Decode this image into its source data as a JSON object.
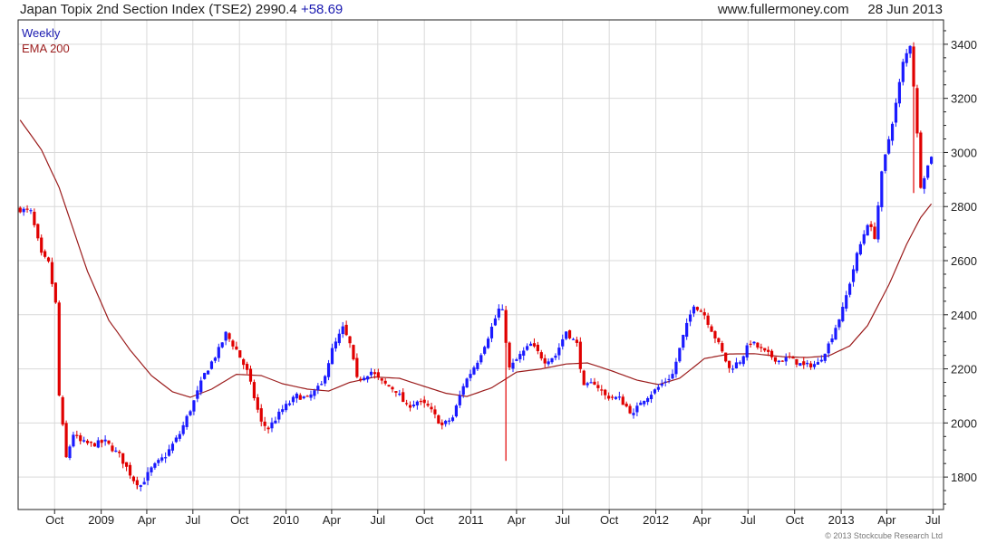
{
  "header": {
    "title": "Japan Topix 2nd Section Index (TSE2)",
    "last_value": "2990.4",
    "change": "+58.69",
    "website": "www.fullermoney.com",
    "date": "28 Jun 2013"
  },
  "copyright": "© 2013 Stockcube Research Ltd",
  "colors": {
    "up": "#1a1aff",
    "down": "#e00000",
    "ema": "#9b1c1c",
    "grid": "#d9d9d9",
    "frame": "#222222",
    "weekly_label": "#1a1ab0"
  },
  "chart_data": {
    "type": "candlestick",
    "frequency_label": "Weekly",
    "ema_label": "EMA 200",
    "x_range": [
      "2008-07-21",
      "2013-07-22"
    ],
    "y_range": [
      1680,
      3490
    ],
    "y_axis_side": "right",
    "grid": true,
    "y_ticks": [
      1800,
      2000,
      2200,
      2400,
      2600,
      2800,
      3000,
      3200,
      3400
    ],
    "x_ticks": [
      {
        "label": "Oct",
        "date": "2008-10-01"
      },
      {
        "label": "2009",
        "date": "2009-01-01"
      },
      {
        "label": "Apr",
        "date": "2009-04-01"
      },
      {
        "label": "Jul",
        "date": "2009-07-01"
      },
      {
        "label": "Oct",
        "date": "2009-10-01"
      },
      {
        "label": "2010",
        "date": "2010-01-01"
      },
      {
        "label": "Apr",
        "date": "2010-04-01"
      },
      {
        "label": "Jul",
        "date": "2010-07-01"
      },
      {
        "label": "Oct",
        "date": "2010-10-01"
      },
      {
        "label": "2011",
        "date": "2011-01-01"
      },
      {
        "label": "Apr",
        "date": "2011-04-01"
      },
      {
        "label": "Jul",
        "date": "2011-07-01"
      },
      {
        "label": "Oct",
        "date": "2011-10-01"
      },
      {
        "label": "2012",
        "date": "2012-01-01"
      },
      {
        "label": "Apr",
        "date": "2012-04-01"
      },
      {
        "label": "Jul",
        "date": "2012-07-01"
      },
      {
        "label": "Oct",
        "date": "2012-10-01"
      },
      {
        "label": "2013",
        "date": "2013-01-01"
      },
      {
        "label": "Apr",
        "date": "2013-04-01"
      },
      {
        "label": "Jul",
        "date": "2013-07-01"
      }
    ],
    "close_path": [
      [
        "2008-07-25",
        2790
      ],
      [
        "2008-08-15",
        2780
      ],
      [
        "2008-09-05",
        2620
      ],
      [
        "2008-09-19",
        2590
      ],
      [
        "2008-10-03",
        2440
      ],
      [
        "2008-10-10",
        2100
      ],
      [
        "2008-10-24",
        1870
      ],
      [
        "2008-11-07",
        1960
      ],
      [
        "2008-11-21",
        1930
      ],
      [
        "2008-12-12",
        1920
      ],
      [
        "2009-01-09",
        1930
      ],
      [
        "2009-02-06",
        1880
      ],
      [
        "2009-03-06",
        1790
      ],
      [
        "2009-03-20",
        1770
      ],
      [
        "2009-04-10",
        1830
      ],
      [
        "2009-05-08",
        1880
      ],
      [
        "2009-06-05",
        1960
      ],
      [
        "2009-07-03",
        2080
      ],
      [
        "2009-07-24",
        2180
      ],
      [
        "2009-08-21",
        2270
      ],
      [
        "2009-09-04",
        2330
      ],
      [
        "2009-09-25",
        2270
      ],
      [
        "2009-10-16",
        2190
      ],
      [
        "2009-11-13",
        2000
      ],
      [
        "2009-11-27",
        1980
      ],
      [
        "2009-12-25",
        2050
      ],
      [
        "2010-01-22",
        2100
      ],
      [
        "2010-02-12",
        2090
      ],
      [
        "2010-03-12",
        2140
      ],
      [
        "2010-04-02",
        2270
      ],
      [
        "2010-04-23",
        2350
      ],
      [
        "2010-05-07",
        2290
      ],
      [
        "2010-05-21",
        2160
      ],
      [
        "2010-06-18",
        2190
      ],
      [
        "2010-07-09",
        2150
      ],
      [
        "2010-08-06",
        2120
      ],
      [
        "2010-08-27",
        2060
      ],
      [
        "2010-09-17",
        2080
      ],
      [
        "2010-10-08",
        2060
      ],
      [
        "2010-11-05",
        1990
      ],
      [
        "2010-11-26",
        2020
      ],
      [
        "2010-12-17",
        2140
      ],
      [
        "2011-01-14",
        2230
      ],
      [
        "2011-02-04",
        2320
      ],
      [
        "2011-02-25",
        2420
      ],
      [
        "2011-03-04",
        2410
      ],
      [
        "2011-03-18",
        2200
      ],
      [
        "2011-04-08",
        2250
      ],
      [
        "2011-04-29",
        2290
      ],
      [
        "2011-05-27",
        2230
      ],
      [
        "2011-06-17",
        2250
      ],
      [
        "2011-07-08",
        2340
      ],
      [
        "2011-07-29",
        2290
      ],
      [
        "2011-08-12",
        2130
      ],
      [
        "2011-09-02",
        2150
      ],
      [
        "2011-09-23",
        2100
      ],
      [
        "2011-10-21",
        2090
      ],
      [
        "2011-11-18",
        2030
      ],
      [
        "2011-12-02",
        2080
      ],
      [
        "2011-12-30",
        2120
      ],
      [
        "2012-02-03",
        2180
      ],
      [
        "2012-02-24",
        2320
      ],
      [
        "2012-03-16",
        2440
      ],
      [
        "2012-04-06",
        2400
      ],
      [
        "2012-05-04",
        2290
      ],
      [
        "2012-05-25",
        2200
      ],
      [
        "2012-06-15",
        2230
      ],
      [
        "2012-07-06",
        2300
      ],
      [
        "2012-08-03",
        2260
      ],
      [
        "2012-08-31",
        2230
      ],
      [
        "2012-09-21",
        2240
      ],
      [
        "2012-10-19",
        2210
      ],
      [
        "2012-11-16",
        2220
      ],
      [
        "2012-12-07",
        2290
      ],
      [
        "2013-01-04",
        2420
      ],
      [
        "2013-02-01",
        2620
      ],
      [
        "2013-02-22",
        2740
      ],
      [
        "2013-03-08",
        2690
      ],
      [
        "2013-03-22",
        2920
      ],
      [
        "2013-04-05",
        3050
      ],
      [
        "2013-04-19",
        3180
      ],
      [
        "2013-05-03",
        3330
      ],
      [
        "2013-05-17",
        3400
      ],
      [
        "2013-05-24",
        3250
      ],
      [
        "2013-06-07",
        2880
      ],
      [
        "2013-06-21",
        2950
      ],
      [
        "2013-06-28",
        2990.4
      ]
    ],
    "ema_200": [
      [
        "2008-07-25",
        3120
      ],
      [
        "2008-09-05",
        3010
      ],
      [
        "2008-10-10",
        2870
      ],
      [
        "2008-12-05",
        2560
      ],
      [
        "2009-01-16",
        2380
      ],
      [
        "2009-02-27",
        2270
      ],
      [
        "2009-04-10",
        2175
      ],
      [
        "2009-05-22",
        2115
      ],
      [
        "2009-06-26",
        2095
      ],
      [
        "2009-08-07",
        2125
      ],
      [
        "2009-09-25",
        2180
      ],
      [
        "2009-11-13",
        2175
      ],
      [
        "2009-12-25",
        2145
      ],
      [
        "2010-02-12",
        2125
      ],
      [
        "2010-03-26",
        2118
      ],
      [
        "2010-05-07",
        2150
      ],
      [
        "2010-06-25",
        2170
      ],
      [
        "2010-08-13",
        2165
      ],
      [
        "2010-10-01",
        2135
      ],
      [
        "2010-11-12",
        2110
      ],
      [
        "2010-12-24",
        2098
      ],
      [
        "2011-02-11",
        2130
      ],
      [
        "2011-04-01",
        2188
      ],
      [
        "2011-05-20",
        2200
      ],
      [
        "2011-07-08",
        2218
      ],
      [
        "2011-08-19",
        2222
      ],
      [
        "2011-10-07",
        2192
      ],
      [
        "2011-11-25",
        2158
      ],
      [
        "2012-01-06",
        2142
      ],
      [
        "2012-02-17",
        2165
      ],
      [
        "2012-04-06",
        2238
      ],
      [
        "2012-05-25",
        2255
      ],
      [
        "2012-07-13",
        2256
      ],
      [
        "2012-09-07",
        2245
      ],
      [
        "2012-10-26",
        2242
      ],
      [
        "2012-12-07",
        2248
      ],
      [
        "2013-01-18",
        2285
      ],
      [
        "2013-02-22",
        2360
      ],
      [
        "2013-04-05",
        2510
      ],
      [
        "2013-05-10",
        2660
      ],
      [
        "2013-06-07",
        2760
      ],
      [
        "2013-06-28",
        2810
      ]
    ],
    "spikes": [
      {
        "date": "2011-03-11",
        "low": 1860
      },
      {
        "date": "2013-05-24",
        "low": 2850
      },
      {
        "date": "2009-03-13",
        "low": 1755
      }
    ]
  }
}
